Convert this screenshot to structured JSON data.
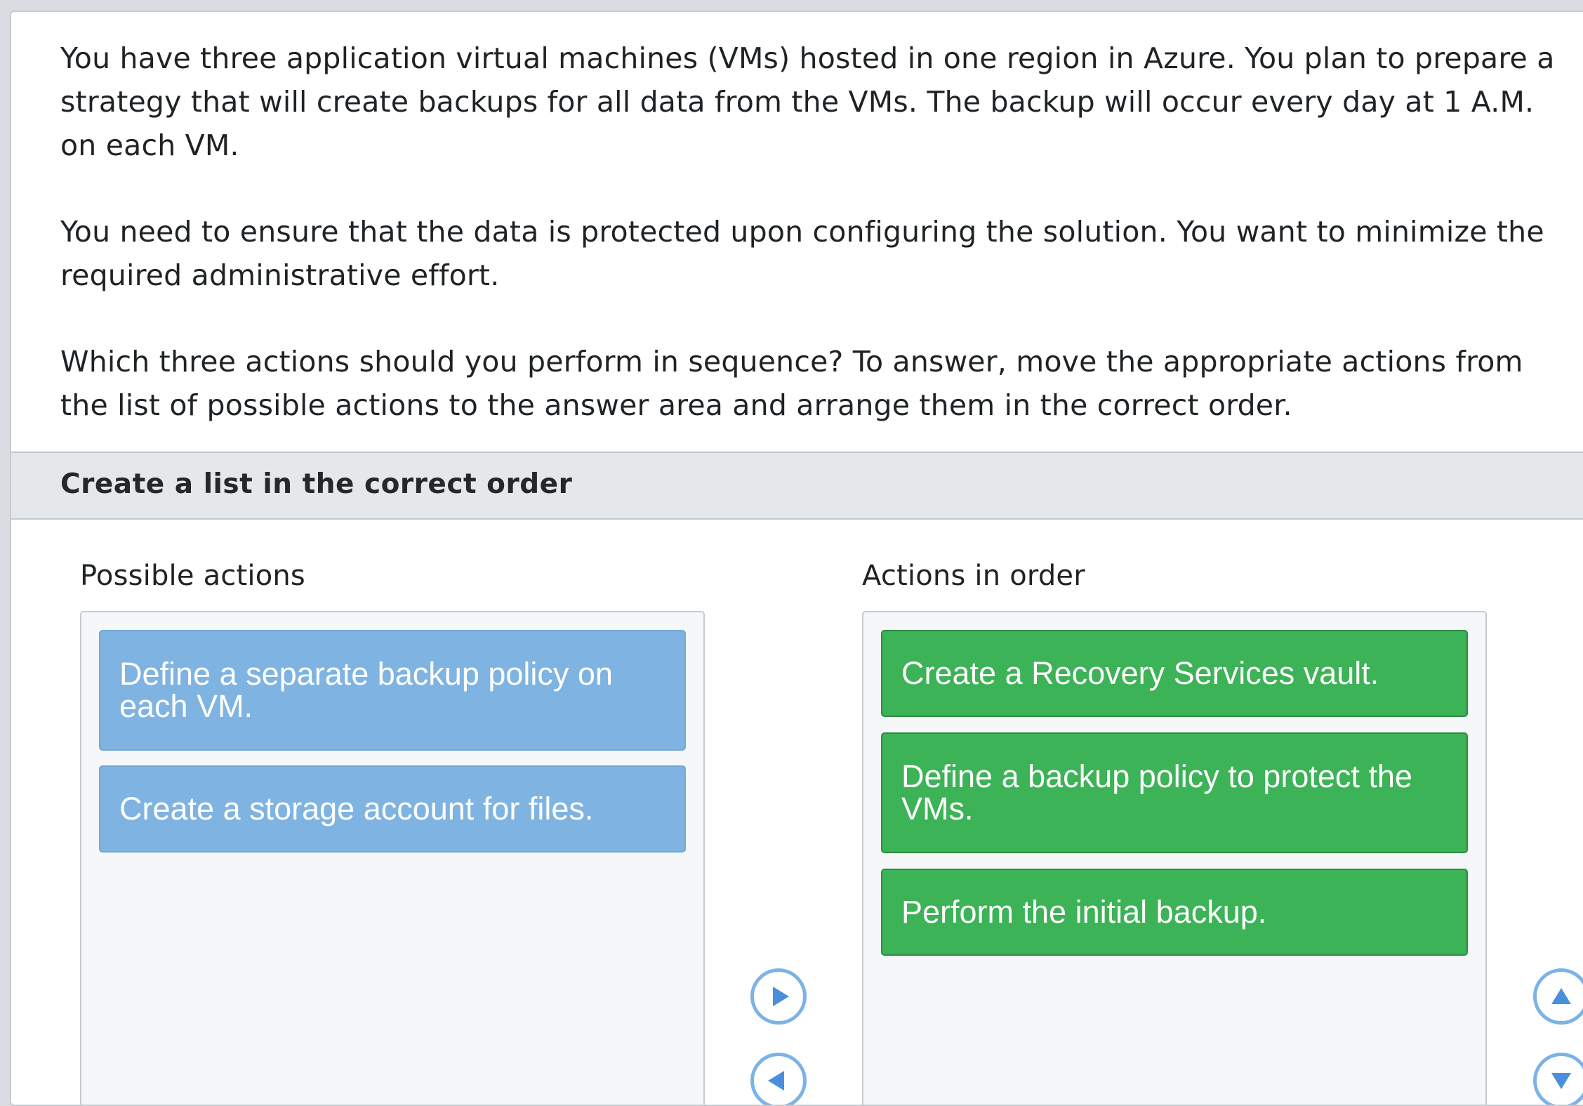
{
  "question": {
    "paragraphs": [
      "You have three application virtual machines (VMs) hosted in one region in Azure. You plan to prepare a strategy that will create backups for all data from the VMs. The backup will occur every day at 1 A.M. on each VM.",
      "You need to ensure that the data is protected upon configuring the solution. You want to minimize the required administrative effort.",
      "Which three actions should you perform in sequence? To answer, move the appropriate actions from the list of possible actions to the answer area and arrange them in the correct order."
    ]
  },
  "section": {
    "title": "Create a list in the correct order"
  },
  "possible_actions": {
    "title": "Possible actions",
    "items": [
      "Define a separate backup policy on each VM.",
      "Create a storage account for files."
    ]
  },
  "actions_in_order": {
    "title": "Actions in order",
    "items": [
      "Create a Recovery Services vault.",
      "Define a backup policy to protect the VMs.",
      "Perform the initial backup."
    ]
  },
  "controls": {
    "move_right_icon": "triangle-right-icon",
    "move_left_icon": "triangle-left-icon",
    "move_up_icon": "triangle-up-icon",
    "move_down_icon": "triangle-down-icon"
  },
  "colors": {
    "possible_item": "#7fb3e2",
    "ordered_item": "#3bb356",
    "control_ring": "#7cb2ea"
  }
}
